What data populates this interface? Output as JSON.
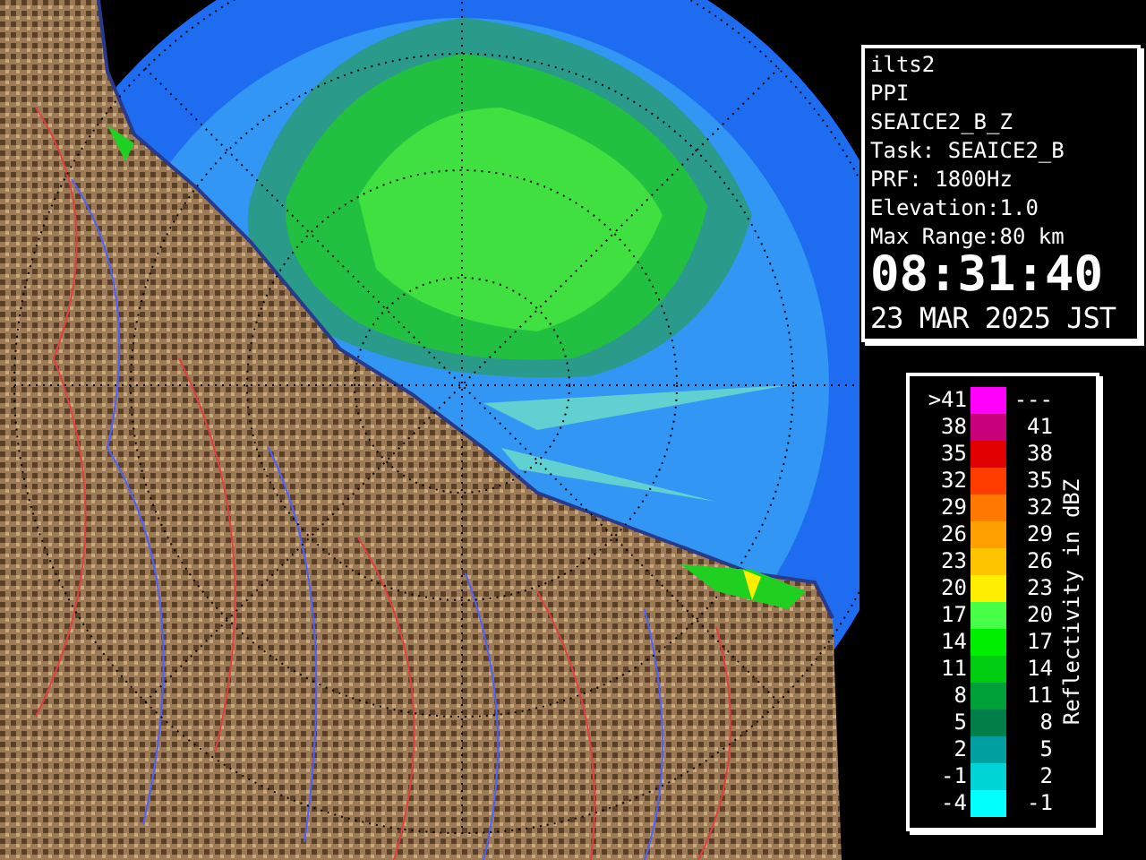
{
  "info": {
    "station": "ilts2",
    "scan_type": "PPI",
    "product": "SEAICE2_B_Z",
    "task": "Task: SEAICE2_B",
    "prf": "PRF: 1800Hz",
    "elevation": "Elevation:1.0",
    "max_range": "Max Range:80 km",
    "time": "08:31:40",
    "date": "23 MAR 2025 JST"
  },
  "legend": {
    "title": "Reflectivity in dBZ",
    "rows": [
      {
        "low": ">41",
        "high": "---",
        "color": "#ff00ff"
      },
      {
        "low": "38",
        "high": "41",
        "color": "#c8007c"
      },
      {
        "low": "35",
        "high": "38",
        "color": "#e00000"
      },
      {
        "low": "32",
        "high": "35",
        "color": "#ff3c00"
      },
      {
        "low": "29",
        "high": "32",
        "color": "#ff7800"
      },
      {
        "low": "26",
        "high": "29",
        "color": "#ffa000"
      },
      {
        "low": "23",
        "high": "26",
        "color": "#ffc400"
      },
      {
        "low": "20",
        "high": "23",
        "color": "#ffee00"
      },
      {
        "low": "17",
        "high": "20",
        "color": "#48ff48"
      },
      {
        "low": "14",
        "high": "17",
        "color": "#00f000"
      },
      {
        "low": "11",
        "high": "14",
        "color": "#00cc10"
      },
      {
        "low": "8",
        "high": "11",
        "color": "#00a038"
      },
      {
        "low": "5",
        "high": "8",
        "color": "#008048"
      },
      {
        "low": "2",
        "high": "5",
        "color": "#00a0a0"
      },
      {
        "low": "-1",
        "high": "2",
        "color": "#00d4d4"
      },
      {
        "low": "-4",
        "high": "-1",
        "color": "#00ffff"
      }
    ]
  }
}
